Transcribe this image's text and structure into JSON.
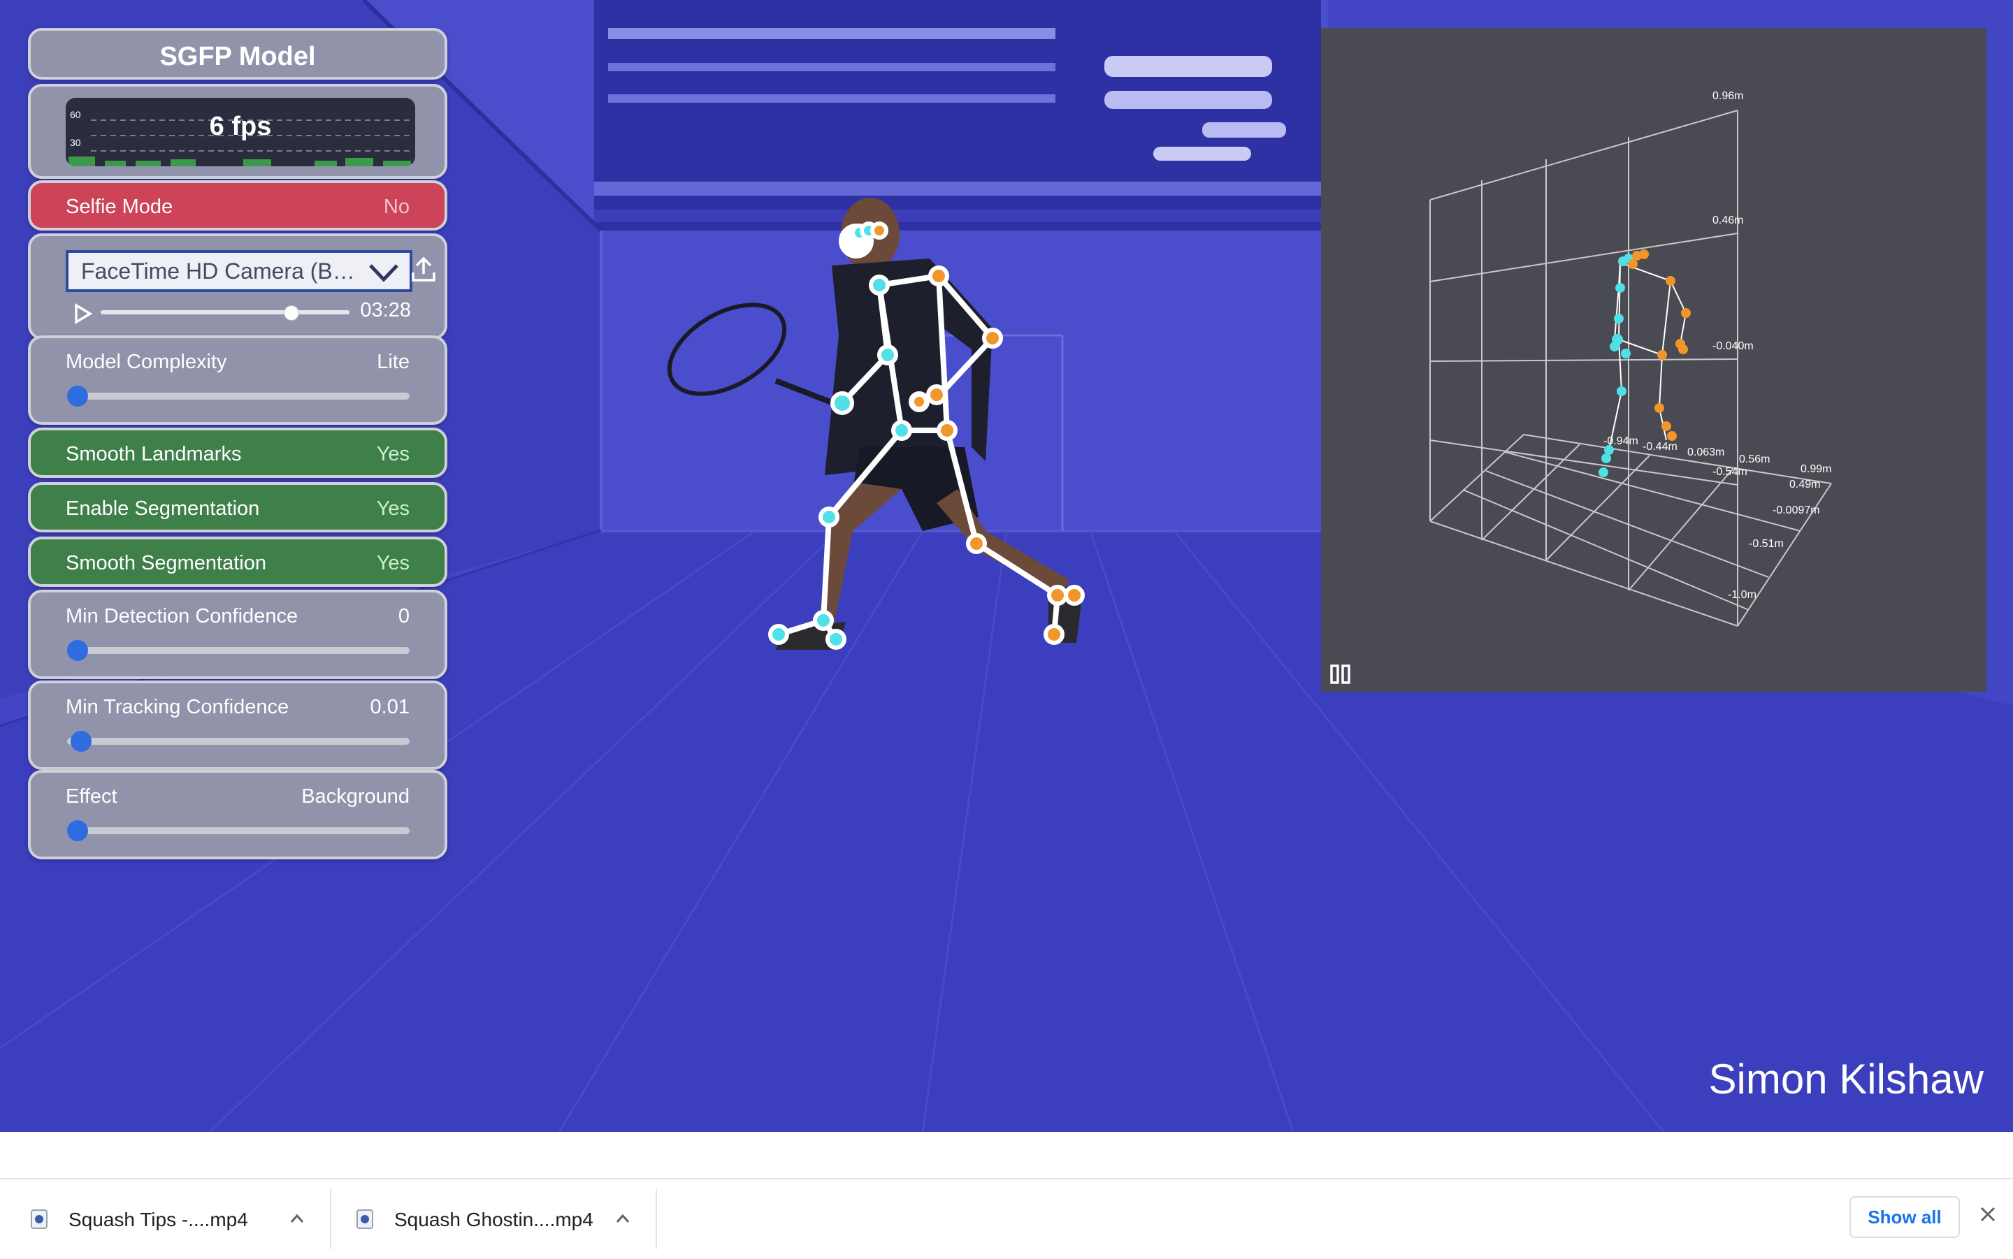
{
  "app": {
    "title": "SGFP Model",
    "fps_label": "6 fps",
    "fps_axis": [
      "60",
      "30"
    ]
  },
  "controls": {
    "selfie_mode": {
      "label": "Selfie Mode",
      "value": "No",
      "color": "#cd4458"
    },
    "camera": {
      "selected": "FaceTime HD Camera (B…",
      "time": "03:28",
      "playback_progress": 0.78
    },
    "model_complexity": {
      "label": "Model Complexity",
      "value": "Lite",
      "slider_level": 0.0
    },
    "smooth_landmarks": {
      "label": "Smooth Landmarks",
      "value": "Yes",
      "color": "#3f7f4a"
    },
    "enable_segmentation": {
      "label": "Enable Segmentation",
      "value": "Yes"
    },
    "smooth_segmentation": {
      "label": "Smooth Segmentation",
      "value": "Yes"
    },
    "min_detection_confidence": {
      "label": "Min Detection Confidence",
      "value": "0",
      "slider_level": 0.0
    },
    "min_tracking_confidence": {
      "label": "Min Tracking Confidence",
      "value": "0.01",
      "slider_level": 0.01
    },
    "effect": {
      "label": "Effect",
      "value": "Background",
      "slider_level": 0.0
    }
  },
  "viewer3d": {
    "axis_labels": [
      "0.96m",
      "0.46m",
      "-0.040m",
      "-0.94m",
      "-0.44m",
      "0.063m",
      "0.56m",
      "-0.54m",
      "0.99m",
      "0.49m",
      "-0.0097m",
      "-0.51m",
      "-1.0m"
    ],
    "landmark_colors": {
      "left": "#4fe0e8",
      "right": "#f0962a"
    },
    "icon": "pause-icon"
  },
  "overlay": {
    "name": "Simon Kilshaw"
  },
  "downloads": {
    "items": [
      {
        "name": "Squash Tips -....mp4"
      },
      {
        "name": "Squash Ghostin....mp4"
      }
    ],
    "show_all": "Show all"
  },
  "colors": {
    "scene": "#4346c4",
    "slider_thumb": "#2f6ce0",
    "show_all": "#1a73e8"
  }
}
